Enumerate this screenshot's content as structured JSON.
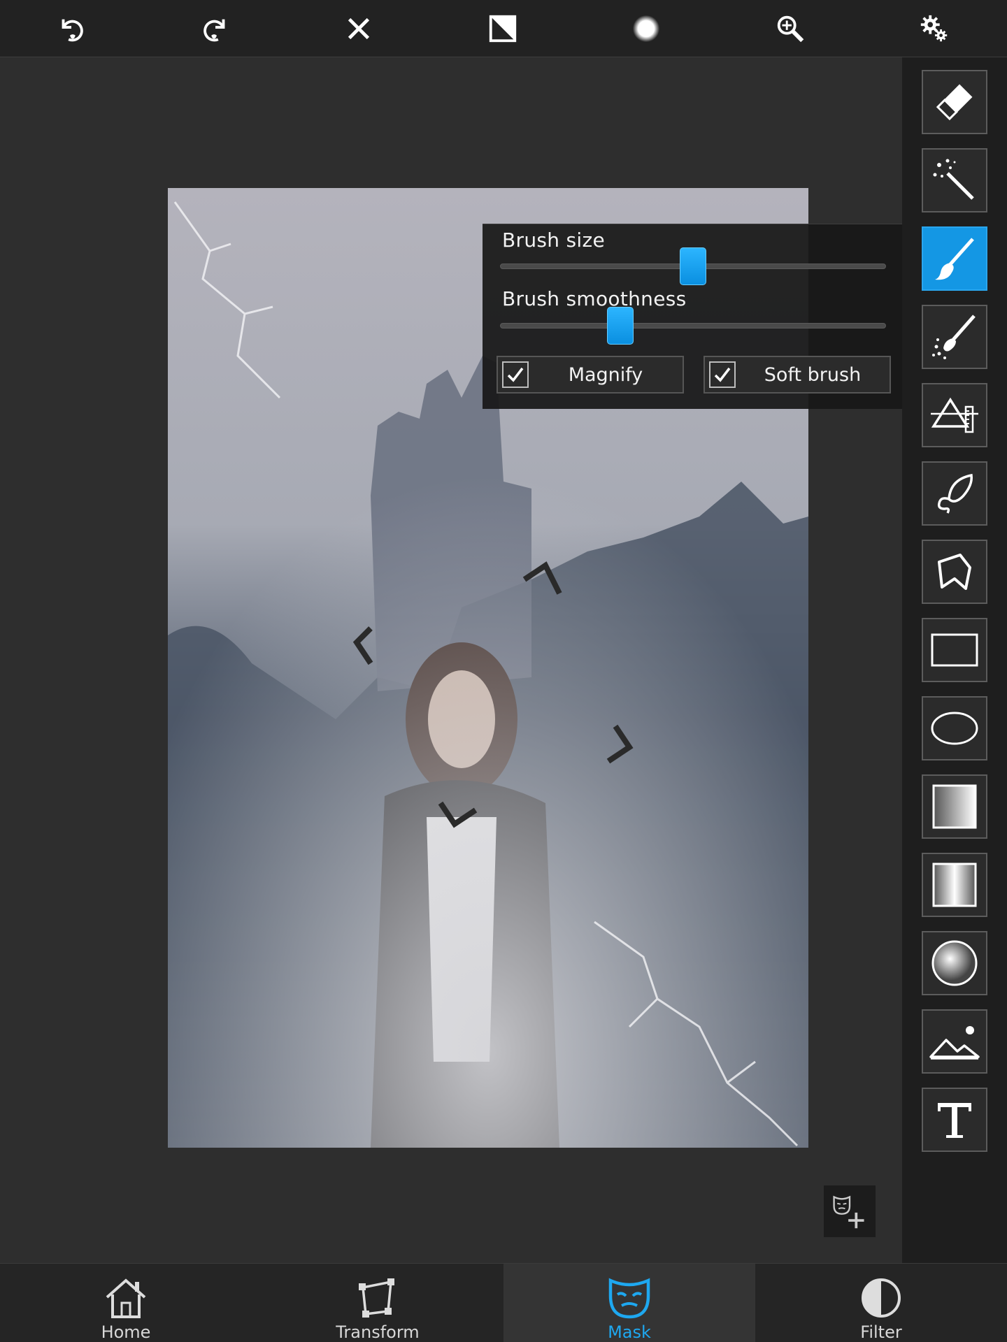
{
  "toolbar": {
    "icons": [
      "undo-icon",
      "redo-icon",
      "close-icon",
      "invert-mask-icon",
      "brush-preview-icon",
      "zoom-in-icon",
      "settings-icon"
    ]
  },
  "brush_panel": {
    "brush_size_label": "Brush size",
    "brush_size_value": 0.5,
    "brush_smoothness_label": "Brush smoothness",
    "brush_smoothness_value": 0.31,
    "magnify": {
      "label": "Magnify",
      "checked": true
    },
    "soft_brush": {
      "label": "Soft brush",
      "checked": true
    }
  },
  "tools": {
    "active": "brush",
    "items": [
      "eraser",
      "magic-wand",
      "brush",
      "sparkle-brush",
      "perspective",
      "lasso",
      "polygon",
      "rectangle",
      "ellipse",
      "linear-gradient",
      "mirror-gradient",
      "radial-gradient",
      "image",
      "text"
    ]
  },
  "colors": {
    "accent": "#1ea8f0",
    "background": "#2d2d2d",
    "panel": "#1e1e1e"
  },
  "nav": {
    "active": "mask",
    "home": "Home",
    "transform": "Transform",
    "mask": "Mask",
    "filter": "Filter"
  }
}
